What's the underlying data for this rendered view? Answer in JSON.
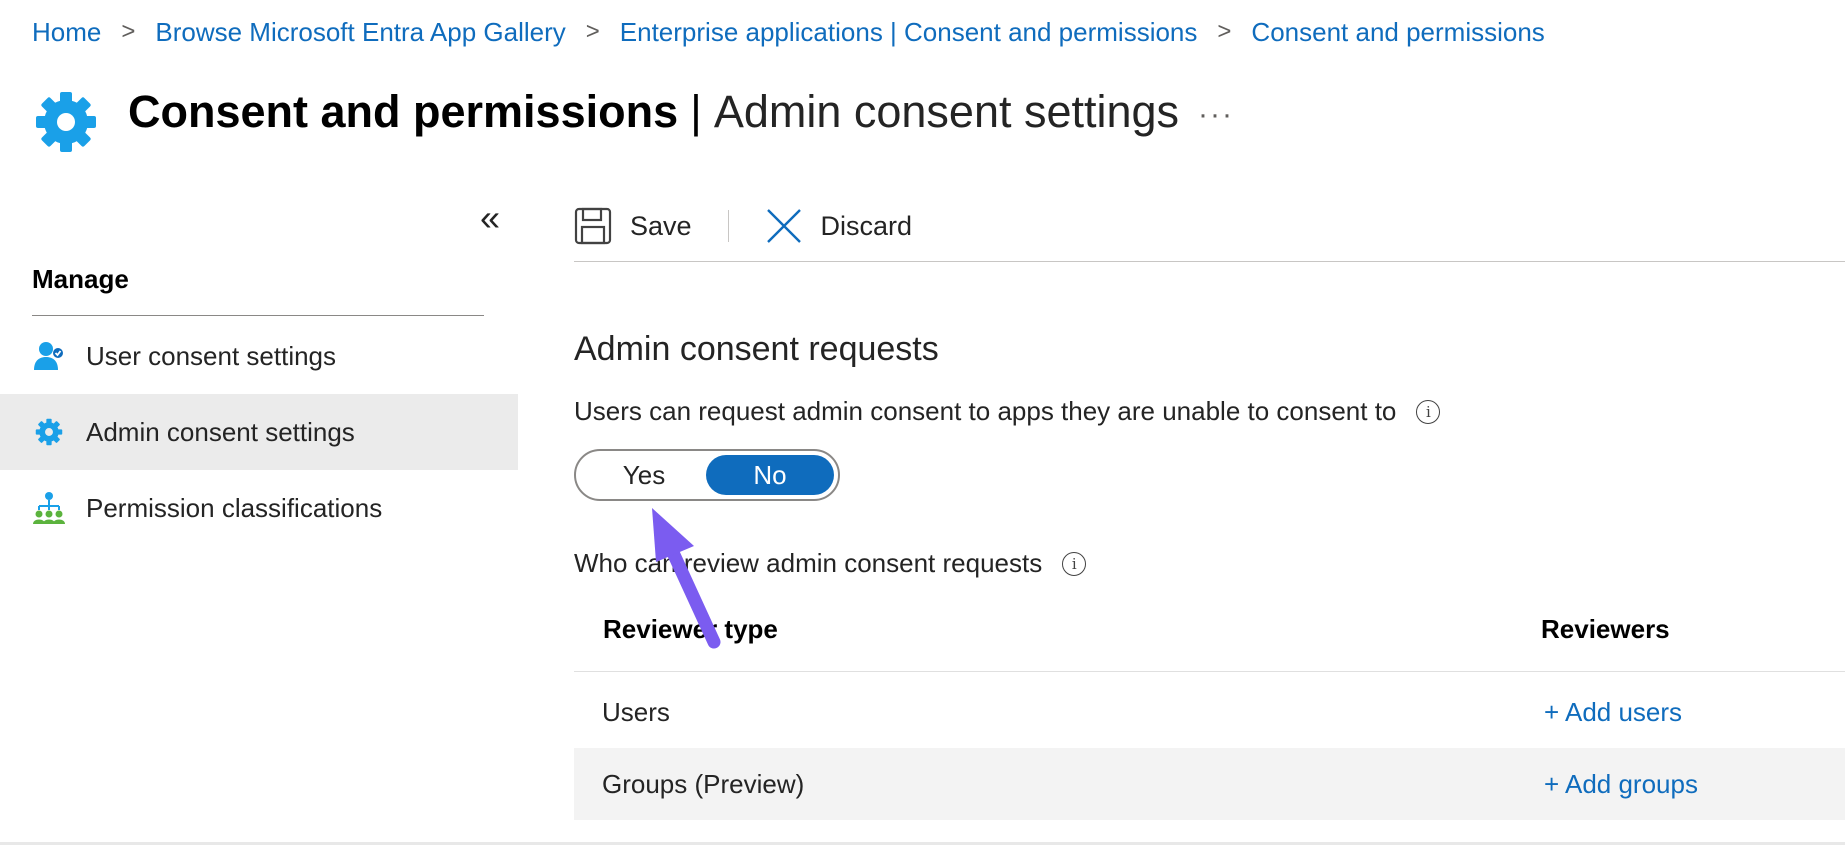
{
  "breadcrumb": {
    "items": [
      "Home",
      "Browse Microsoft Entra App Gallery",
      "Enterprise applications | Consent and permissions",
      "Consent and permissions"
    ],
    "separator": ">"
  },
  "header": {
    "title_bold": "Consent and permissions",
    "title_separator": "|",
    "title_sub": "Admin consent settings",
    "more_label": "···",
    "icon": "gear-icon"
  },
  "sidebar": {
    "collapse_label": "«",
    "section_label": "Manage",
    "items": [
      {
        "label": "User consent settings",
        "icon": "user-consent-icon",
        "selected": false
      },
      {
        "label": "Admin consent settings",
        "icon": "gear-icon",
        "selected": true
      },
      {
        "label": "Permission classifications",
        "icon": "permission-hierarchy-icon",
        "selected": false
      }
    ]
  },
  "toolbar": {
    "save_label": "Save",
    "discard_label": "Discard"
  },
  "main": {
    "section_title": "Admin consent requests",
    "request_question": "Users can request admin consent to apps they are unable to consent to",
    "toggle": {
      "yes_label": "Yes",
      "no_label": "No",
      "selected": "No"
    },
    "reviewer_question": "Who can review admin consent requests",
    "info_icon": "i",
    "table": {
      "headers": [
        "Reviewer type",
        "Reviewers"
      ],
      "rows": [
        {
          "type": "Users",
          "action": "+ Add users"
        },
        {
          "type": "Groups (Preview)",
          "action": "+ Add groups"
        }
      ]
    }
  },
  "colors": {
    "link": "#0f6cbd",
    "accent": "#0f6cbd",
    "gear": "#1aa0e8",
    "annotation_arrow": "#7b5cf0",
    "selected_nav_bg": "#ebebeb"
  }
}
